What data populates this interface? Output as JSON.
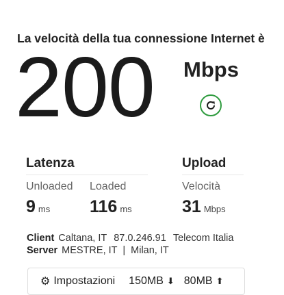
{
  "headline": "La velocità della tua connessione Internet è",
  "speed": {
    "value": "200",
    "unit": "Mbps"
  },
  "refresh": {
    "icon": "refresh-icon",
    "color": "#2e9b3e"
  },
  "latency": {
    "title": "Latenza",
    "unloaded": {
      "label": "Unloaded",
      "value": "9",
      "unit": "ms"
    },
    "loaded": {
      "label": "Loaded",
      "value": "116",
      "unit": "ms"
    }
  },
  "upload": {
    "title": "Upload",
    "speed": {
      "label": "Velocità",
      "value": "31",
      "unit": "Mbps"
    }
  },
  "client": {
    "label": "Client",
    "location": "Caltana, IT",
    "ip": "87.0.246.91",
    "isp": "Telecom Italia"
  },
  "server": {
    "label": "Server",
    "text": "MESTRE, IT  |  Milan, IT"
  },
  "settings": {
    "label": "Impostazioni",
    "icon": "gear-icon",
    "download_amount": "150MB",
    "download_icon": "download-arrow-icon",
    "upload_amount": "80MB",
    "upload_icon": "upload-arrow-icon"
  }
}
